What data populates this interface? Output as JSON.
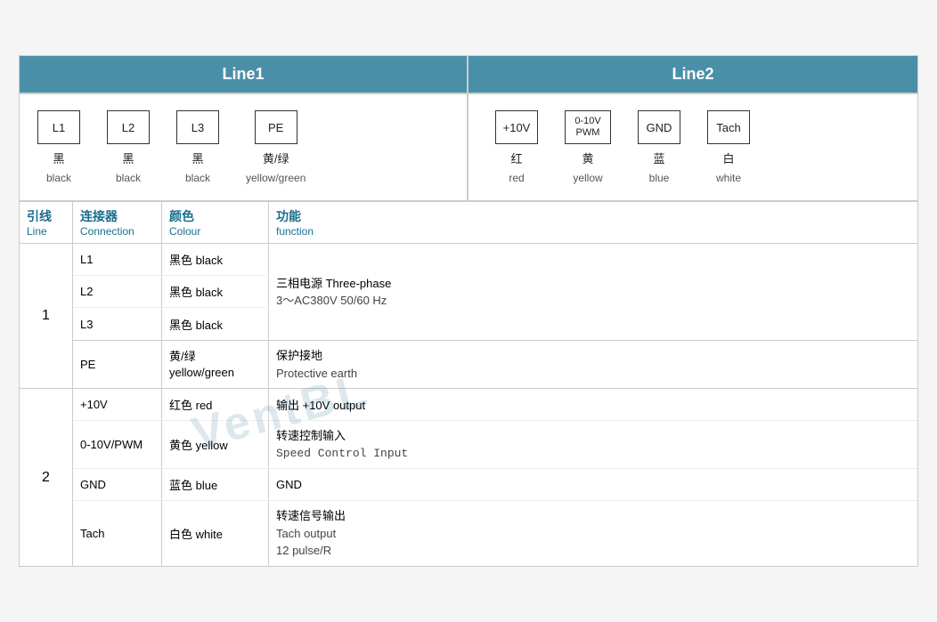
{
  "header": {
    "line1_label": "Line1",
    "line2_label": "Line2"
  },
  "line1_connectors": [
    {
      "id": "L1",
      "cn": "黑",
      "en": "black"
    },
    {
      "id": "L2",
      "cn": "黑",
      "en": "black"
    },
    {
      "id": "L3",
      "cn": "黑",
      "en": "black"
    },
    {
      "id": "PE",
      "cn": "黄/绿",
      "en": "yellow/green"
    }
  ],
  "line2_connectors": [
    {
      "id": "+10V",
      "cn": "红",
      "en": "red"
    },
    {
      "id": "0-10V\nPWM",
      "display": "0-10V PWM",
      "cn": "黄",
      "en": "yellow"
    },
    {
      "id": "GND",
      "cn": "蓝",
      "en": "blue"
    },
    {
      "id": "Tach",
      "cn": "白",
      "en": "white"
    }
  ],
  "table": {
    "col_line": "引线",
    "col_line_sub": "Line",
    "col_conn": "连接器",
    "col_conn_sub": "Connection",
    "col_colour": "颜色",
    "col_colour_sub": "Colour",
    "col_func": "功能",
    "col_func_sub": "function"
  },
  "groups": [
    {
      "line": "1",
      "rows": [
        {
          "conn": "L1",
          "colour": "黑色 black",
          "func_cn": "三相电源 Three-phase",
          "func_en": "3～AC380V 50/60 Hz",
          "rowspan": true
        },
        {
          "conn": "L2",
          "colour": "黑色 black",
          "func_cn": "",
          "func_en": ""
        },
        {
          "conn": "L3",
          "colour": "黑色 black",
          "func_cn": "",
          "func_en": ""
        },
        {
          "conn": "PE",
          "colour": "黄/绿\nyellow/green",
          "func_cn": "保护接地",
          "func_en": "Protective earth"
        }
      ]
    },
    {
      "line": "2",
      "rows": [
        {
          "conn": "+10V",
          "colour": "红色 red",
          "func_cn": "输出 +10V output",
          "func_en": ""
        },
        {
          "conn": "0-10V/PWM",
          "colour": "黄色 yellow",
          "func_cn": "转速控制输入",
          "func_en": "Speed Control Input"
        },
        {
          "conn": "GND",
          "colour": "蓝色 blue",
          "func_cn": "GND",
          "func_en": ""
        },
        {
          "conn": "Tach",
          "colour": "白色 white",
          "func_cn": "转速信号输出",
          "func_en": "Tach output\n12 pulse/R"
        }
      ]
    }
  ],
  "watermark": "VentBL"
}
